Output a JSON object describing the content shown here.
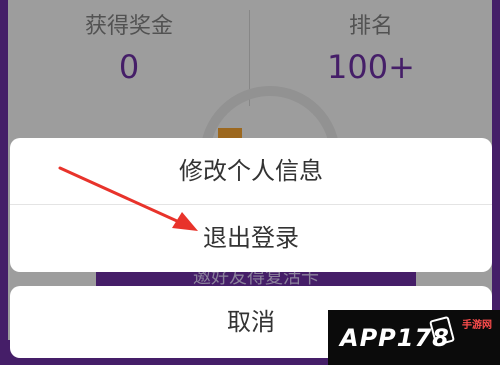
{
  "stats": {
    "reward_label": "获得奖金",
    "reward_value": "0",
    "rank_label": "排名",
    "rank_value": "100+"
  },
  "invite_button": {
    "label": "邀好友得复活卡"
  },
  "action_sheet": {
    "items": [
      {
        "label": "修改个人信息"
      },
      {
        "label": "退出登录"
      }
    ],
    "cancel_label": "取消"
  },
  "annotation": {
    "arrow_color": "#e8332b"
  },
  "watermark": {
    "brand": "APP178",
    "site": "手游网"
  },
  "colors": {
    "brand_purple": "#6a2fa0",
    "accent_orange": "#f0a030"
  }
}
